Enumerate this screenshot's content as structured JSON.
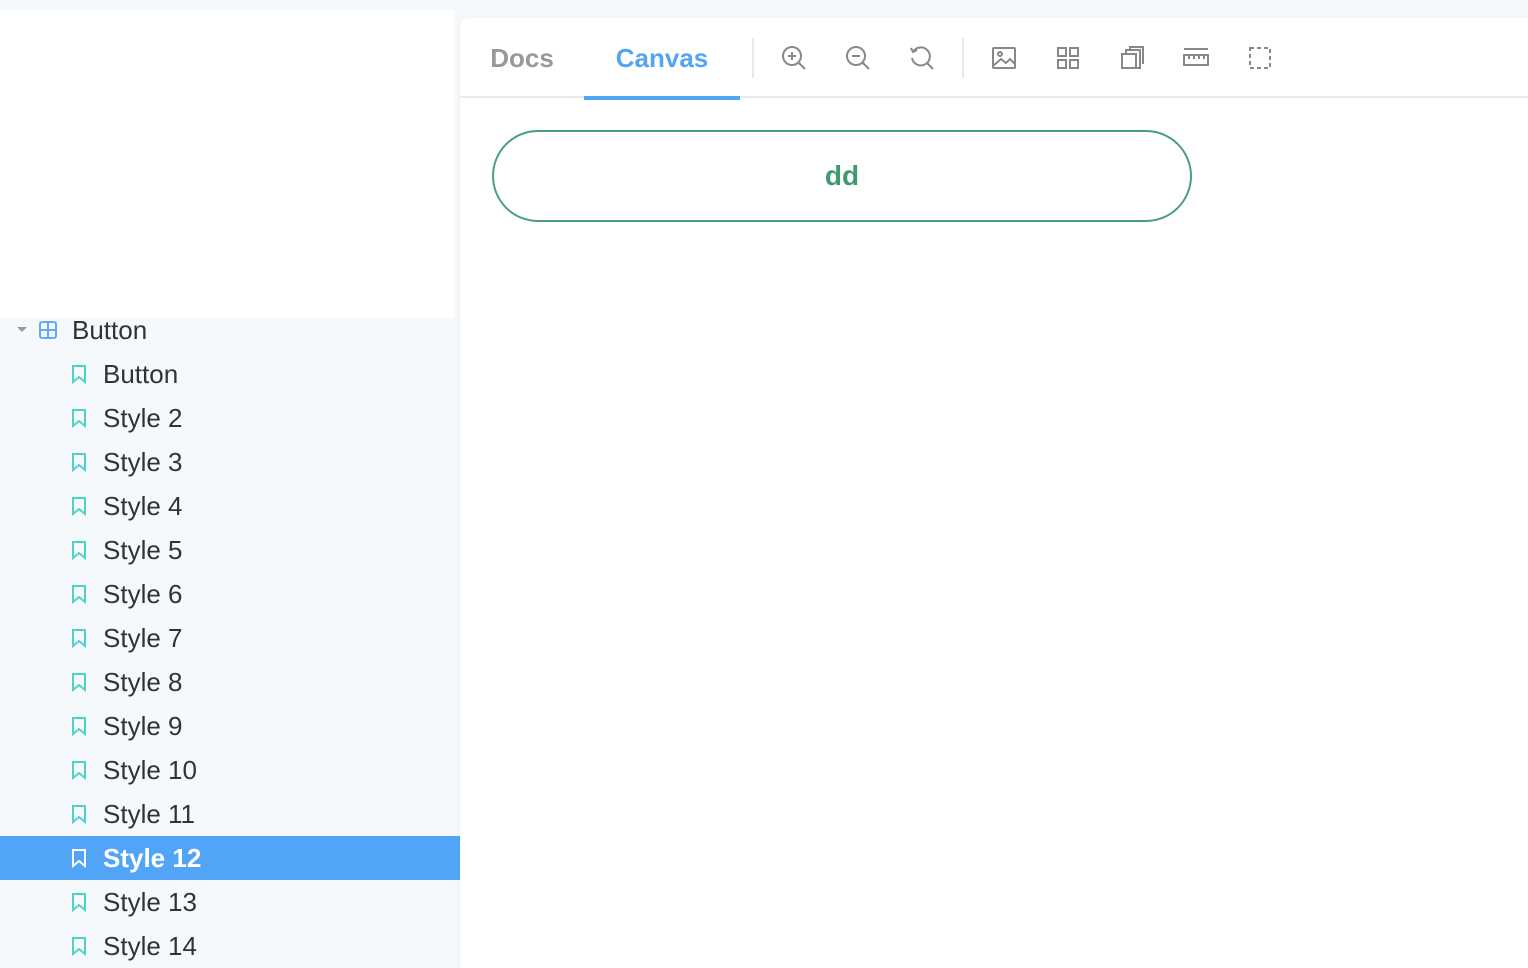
{
  "sidebar": {
    "group": {
      "label": "Button",
      "expanded": true
    },
    "stories": [
      {
        "label": "Button",
        "selected": false
      },
      {
        "label": "Style 2",
        "selected": false
      },
      {
        "label": "Style 3",
        "selected": false
      },
      {
        "label": "Style 4",
        "selected": false
      },
      {
        "label": "Style 5",
        "selected": false
      },
      {
        "label": "Style 6",
        "selected": false
      },
      {
        "label": "Style 7",
        "selected": false
      },
      {
        "label": "Style 8",
        "selected": false
      },
      {
        "label": "Style 9",
        "selected": false
      },
      {
        "label": "Style 10",
        "selected": false
      },
      {
        "label": "Style 11",
        "selected": false
      },
      {
        "label": "Style 12",
        "selected": true
      },
      {
        "label": "Style 13",
        "selected": false
      },
      {
        "label": "Style 14",
        "selected": false
      }
    ]
  },
  "toolbar": {
    "tabs": [
      {
        "label": "Docs",
        "active": false
      },
      {
        "label": "Canvas",
        "active": true
      }
    ],
    "tools": [
      "zoom-in-icon",
      "zoom-out-icon",
      "reset-zoom-icon",
      "background-image-icon",
      "grid-icon",
      "viewport-icon",
      "measure-ruler-icon",
      "outline-icon"
    ]
  },
  "canvas": {
    "button_label": "dd"
  },
  "colors": {
    "accent": "#52a4f6",
    "story_icon": "#4fd1c5",
    "group_icon": "#52a4f6",
    "preview_border": "#4a9f7b",
    "preview_text": "#3f9a70",
    "sidebar_bg": "#f6f9fc"
  }
}
